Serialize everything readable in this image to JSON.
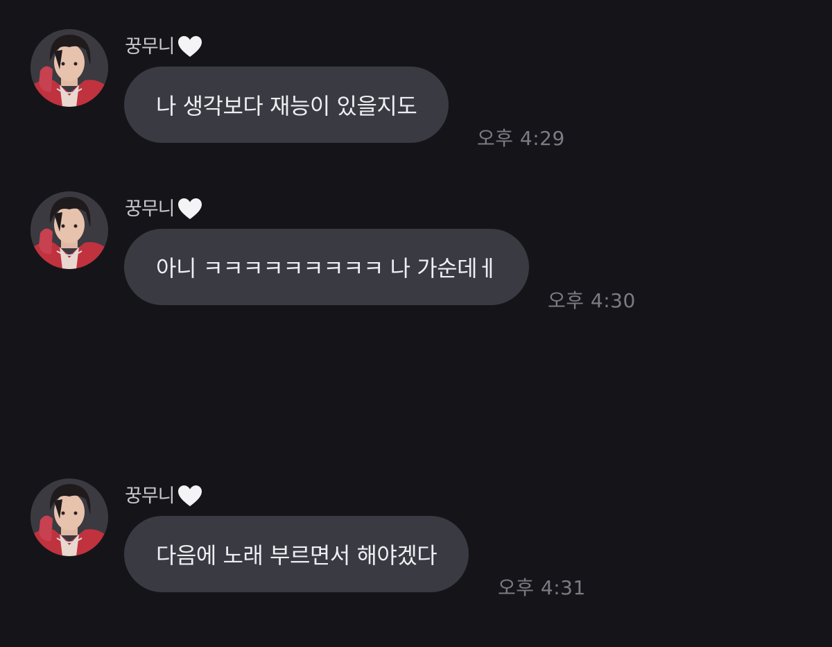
{
  "conversation": {
    "messages": [
      {
        "sender": "꿍무니",
        "text": "나 생각보다 재능이 있을지도",
        "time": "오후 4:29"
      },
      {
        "sender": "꿍무니",
        "text": "아니 ㅋㅋㅋㅋㅋㅋㅋㅋㅋ 나 가순데ㅔ",
        "time": "오후 4:30"
      },
      {
        "sender": "꿍무니",
        "text": "다음에 노래 부르면서 해야겠다",
        "time": "오후 4:31"
      }
    ]
  },
  "icons": {
    "sender_suffix": "white-heart-icon",
    "avatar": "profile-photo"
  },
  "colors": {
    "background": "#151519",
    "bubble": "#3a3a43",
    "bubble_text": "#efeff3",
    "sender_name": "#c9c9cf",
    "timestamp": "#7c7c84",
    "heart": "#f4f4f6"
  }
}
